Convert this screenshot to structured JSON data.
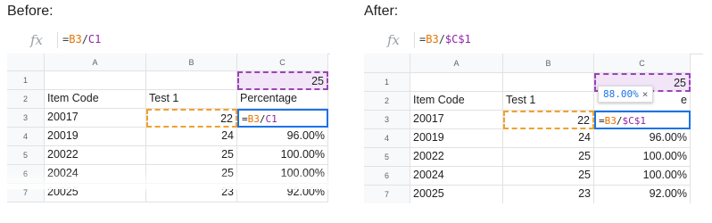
{
  "before": {
    "heading": "Before:",
    "formula_bar": {
      "fx": "fx",
      "eq": "=",
      "ref1": "B3",
      "slash": "/",
      "ref2": "C1"
    },
    "columns": [
      "A",
      "B",
      "C"
    ],
    "rows": [
      {
        "num": "1",
        "a": "",
        "b": "",
        "c": "25"
      },
      {
        "num": "2",
        "a": "Item Code",
        "b": "Test 1",
        "c": "Percentage"
      },
      {
        "num": "3",
        "a": "20017",
        "b": "22",
        "c_eq": "=",
        "c_ref1": "B3",
        "c_slash": "/",
        "c_ref2": "C1"
      },
      {
        "num": "4",
        "a": "20019",
        "b": "24",
        "c": "96.00%"
      },
      {
        "num": "5",
        "a": "20022",
        "b": "25",
        "c": "100.00%"
      },
      {
        "num": "6",
        "a": "20024",
        "b": "25",
        "c": "100.00%"
      },
      {
        "num": "7",
        "a": "20025",
        "b": "23",
        "c": "92.00%"
      }
    ]
  },
  "after": {
    "heading": "After:",
    "formula_bar": {
      "fx": "fx",
      "eq": "=",
      "ref1": "B3",
      "slash": "/",
      "ref2": "$C$1"
    },
    "columns": [
      "A",
      "B",
      "C"
    ],
    "tooltip": {
      "value": "88.00%",
      "close": "×"
    },
    "rows": [
      {
        "num": "1",
        "a": "",
        "b": "",
        "c": "25"
      },
      {
        "num": "2",
        "a": "Item Code",
        "b": "Test 1",
        "c": "e"
      },
      {
        "num": "3",
        "a": "20017",
        "b": "22",
        "c_eq": "=",
        "c_ref1": "B3",
        "c_slash": "/",
        "c_ref2": "$C$1"
      },
      {
        "num": "4",
        "a": "20019",
        "b": "24",
        "c": "96.00%"
      },
      {
        "num": "5",
        "a": "20022",
        "b": "25",
        "c": "100.00%"
      },
      {
        "num": "6",
        "a": "20024",
        "b": "25",
        "c": "100.00%"
      },
      {
        "num": "7",
        "a": "20025",
        "b": "23",
        "c": "92.00%"
      }
    ]
  },
  "colors": {
    "purple_border": "#9a44b6",
    "purple_fill": "#f1e5f7",
    "orange": "#f0a12d",
    "blue": "#1a73e8"
  }
}
